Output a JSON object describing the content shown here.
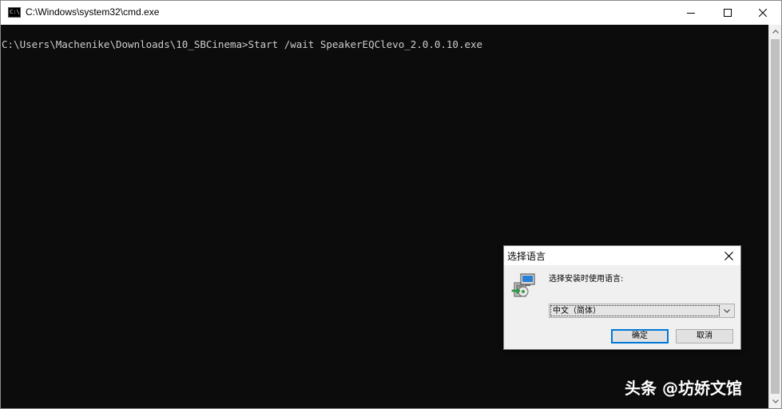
{
  "window": {
    "title": "C:\\Windows\\system32\\cmd.exe",
    "icon_label": "C:\\",
    "controls": {
      "minimize_icon": "minimize-icon",
      "maximize_icon": "maximize-icon",
      "close_icon": "close-icon"
    }
  },
  "console": {
    "line": "C:\\Users\\Machenike\\Downloads\\10_SBCinema>Start /wait SpeakerEQClevo_2.0.0.10.exe",
    "background": "#0c0c0c",
    "foreground": "#cccccc"
  },
  "dialog": {
    "title": "选择语言",
    "prompt": "选择安装时使用语言:",
    "selected_language": "中文（简体）",
    "ok_label": "确定",
    "cancel_label": "取消",
    "accent": "#0078d7"
  },
  "watermark": {
    "text": "头条 @坊娇文馆"
  }
}
